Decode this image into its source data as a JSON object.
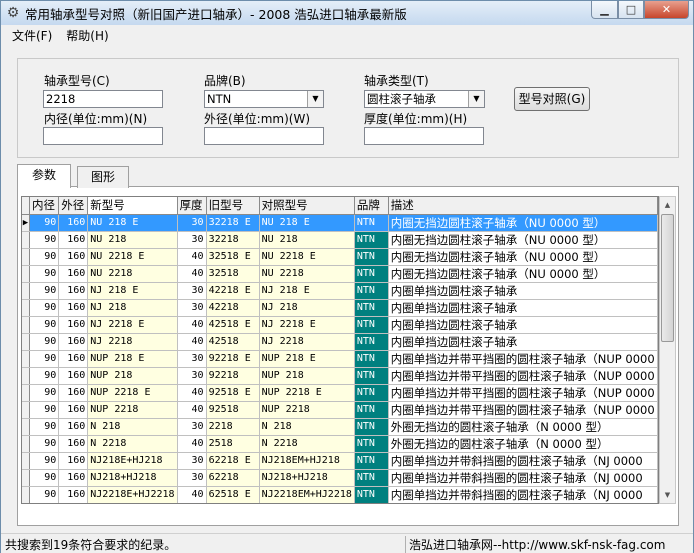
{
  "window": {
    "title": "常用轴承型号对照（新旧国产进口轴承）- 2008 浩弘进口轴承最新版",
    "min_glyph": "▁",
    "max_glyph": "□",
    "close_glyph": "✕"
  },
  "menu": {
    "file": "文件(F)",
    "help": "帮助(H)"
  },
  "form": {
    "model_label": "轴承型号(C)",
    "model_value": "2218",
    "brand_label": "品牌(B)",
    "brand_value": "NTN",
    "type_label": "轴承类型(T)",
    "type_value": "圆柱滚子轴承",
    "inner_label": "内径(单位:mm)(N)",
    "inner_value": "",
    "outer_label": "外径(单位:mm)(W)",
    "outer_value": "",
    "width_label": "厚度(单位:mm)(H)",
    "width_value": "",
    "compare_button": "型号对照(G)"
  },
  "tabs": {
    "params": "参数",
    "drawing": "图形"
  },
  "grid": {
    "headers": [
      "内径",
      "外径",
      "新型号",
      "厚度",
      "旧型号",
      "对照型号",
      "品牌",
      "描述"
    ],
    "rows": [
      [
        "90",
        "160",
        "NU 218 E",
        "30",
        "32218 E",
        "NU 218 E",
        "NTN",
        "内圈无挡边圆柱滚子轴承（NU 0000 型）"
      ],
      [
        "90",
        "160",
        "NU 218",
        "30",
        "32218",
        "NU 218",
        "NTN",
        "内圈无挡边圆柱滚子轴承（NU 0000 型）"
      ],
      [
        "90",
        "160",
        "NU 2218 E",
        "40",
        "32518 E",
        "NU 2218 E",
        "NTN",
        "内圈无挡边圆柱滚子轴承（NU 0000 型）"
      ],
      [
        "90",
        "160",
        "NU 2218",
        "40",
        "32518",
        "NU 2218",
        "NTN",
        "内圈无挡边圆柱滚子轴承（NU 0000 型）"
      ],
      [
        "90",
        "160",
        "NJ 218 E",
        "30",
        "42218 E",
        "NJ 218 E",
        "NTN",
        "内圈单挡边圆柱滚子轴承"
      ],
      [
        "90",
        "160",
        "NJ 218",
        "30",
        "42218",
        "NJ 218",
        "NTN",
        "内圈单挡边圆柱滚子轴承"
      ],
      [
        "90",
        "160",
        "NJ 2218 E",
        "40",
        "42518 E",
        "NJ 2218 E",
        "NTN",
        "内圈单挡边圆柱滚子轴承"
      ],
      [
        "90",
        "160",
        "NJ 2218",
        "40",
        "42518",
        "NJ 2218",
        "NTN",
        "内圈单挡边圆柱滚子轴承"
      ],
      [
        "90",
        "160",
        "NUP 218 E",
        "30",
        "92218 E",
        "NUP 218 E",
        "NTN",
        "内圈单挡边并带平挡圈的圆柱滚子轴承（NUP 0000"
      ],
      [
        "90",
        "160",
        "NUP 218",
        "30",
        "92218",
        "NUP 218",
        "NTN",
        "内圈单挡边并带平挡圈的圆柱滚子轴承（NUP 0000"
      ],
      [
        "90",
        "160",
        "NUP 2218 E",
        "40",
        "92518 E",
        "NUP 2218 E",
        "NTN",
        "内圈单挡边并带平挡圈的圆柱滚子轴承（NUP 0000"
      ],
      [
        "90",
        "160",
        "NUP 2218",
        "40",
        "92518",
        "NUP 2218",
        "NTN",
        "内圈单挡边并带平挡圈的圆柱滚子轴承（NUP 0000"
      ],
      [
        "90",
        "160",
        "N 218",
        "30",
        "2218",
        "N 218",
        "NTN",
        "外圈无挡边的圆柱滚子轴承（N 0000 型）"
      ],
      [
        "90",
        "160",
        "N 2218",
        "40",
        "2518",
        "N 2218",
        "NTN",
        "外圈无挡边的圆柱滚子轴承（N 0000 型）"
      ],
      [
        "90",
        "160",
        "NJ218E+HJ218",
        "30",
        "62218 E",
        "NJ218EM+HJ218",
        "NTN",
        "内圈单挡边并带斜挡圈的圆柱滚子轴承（NJ 0000"
      ],
      [
        "90",
        "160",
        "NJ218+HJ218",
        "30",
        "62218",
        "NJ218+HJ218",
        "NTN",
        "内圈单挡边并带斜挡圈的圆柱滚子轴承（NJ 0000"
      ],
      [
        "90",
        "160",
        "NJ2218E+HJ2218",
        "40",
        "62518 E",
        "NJ2218EM+HJ2218",
        "NTN",
        "内圈单挡边并带斜挡圈的圆柱滚子轴承（NJ 0000"
      ]
    ]
  },
  "status": {
    "left": "共搜索到19条符合要求的纪录。",
    "right": "浩弘进口轴承网--http://www.skf-nsk-fag.com"
  },
  "colors": {
    "brand_cell": "#00807f",
    "selection": "#3399ff",
    "model_cell": "#ffffe1"
  }
}
